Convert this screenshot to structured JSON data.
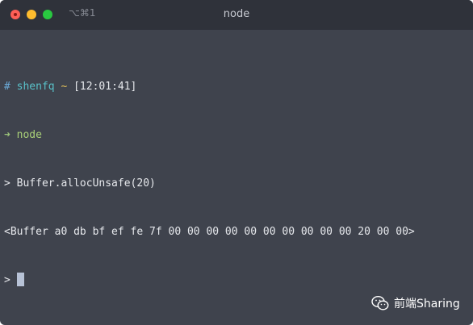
{
  "window": {
    "shortcut": "⌥⌘1",
    "title": "node"
  },
  "terminal": {
    "prompt": {
      "hash": "#",
      "user": "shenfq",
      "tilde": "~",
      "time": "[12:01:41]"
    },
    "command1": {
      "arrow": "➜",
      "text": "node"
    },
    "repl_line1": {
      "prompt": ">",
      "input": "Buffer.allocUnsafe(20)"
    },
    "output": "<Buffer a0 db bf ef fe 7f 00 00 00 00 00 00 00 00 00 00 20 00 00>",
    "repl_line2": {
      "prompt": ">"
    }
  },
  "watermark": {
    "icon": "wechat-icon",
    "text": "前端Sharing"
  },
  "colors": {
    "terminal_bg": "#3f434d",
    "titlebar_bg": "#2f323a",
    "hash": "#6aa9d6",
    "user": "#59c1c9",
    "tilde": "#e6c35a",
    "arrow": "#9bc47a",
    "node": "#a8cf78",
    "text": "#e6e8ec"
  }
}
